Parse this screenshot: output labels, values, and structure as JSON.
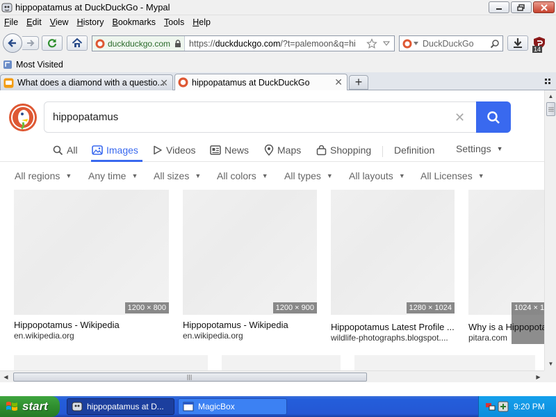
{
  "window": {
    "title": "hippopatamus at DuckDuckGo - Mypal"
  },
  "menu": [
    {
      "label": "File",
      "u": "F",
      "rest": "ile"
    },
    {
      "label": "Edit",
      "u": "E",
      "rest": "dit"
    },
    {
      "label": "View",
      "u": "V",
      "rest": "iew"
    },
    {
      "label": "History",
      "u": "H",
      "rest": "istory"
    },
    {
      "label": "Bookmarks",
      "u": "B",
      "rest": "ookmarks"
    },
    {
      "label": "Tools",
      "u": "T",
      "rest": "ools"
    },
    {
      "label": "Help",
      "u": "H",
      "rest": "elp"
    }
  ],
  "navbar": {
    "identity_site": "duckduckgo.com",
    "url_scheme": "https://",
    "url_host": "duckduckgo.com",
    "url_rest": "/?t=palemoon&q=hi",
    "search_placeholder": "DuckDuckGo",
    "addon_badge": "14"
  },
  "bookmarks": {
    "most_visited": "Most Visited"
  },
  "tabs": [
    {
      "label": "What does a diamond with a questio...",
      "active": false
    },
    {
      "label": "hippopatamus at DuckDuckGo",
      "active": true
    }
  ],
  "search": {
    "query": "hippopatamus"
  },
  "verticals": [
    {
      "label": "All",
      "icon": "search-icon"
    },
    {
      "label": "Images",
      "icon": "image-icon",
      "active": true
    },
    {
      "label": "Videos",
      "icon": "play-icon"
    },
    {
      "label": "News",
      "icon": "news-icon"
    },
    {
      "label": "Maps",
      "icon": "map-pin-icon"
    },
    {
      "label": "Shopping",
      "icon": "shopping-bag-icon"
    },
    {
      "label": "Definition",
      "icon": ""
    },
    {
      "label": "Settings",
      "icon": "chevron-down-icon"
    }
  ],
  "filters": [
    {
      "label": "All regions"
    },
    {
      "label": "Any time"
    },
    {
      "label": "All sizes"
    },
    {
      "label": "All colors"
    },
    {
      "label": "All types"
    },
    {
      "label": "All layouts"
    },
    {
      "label": "All Licenses"
    }
  ],
  "results": [
    {
      "title": "Hippopotamus - Wikipedia",
      "source": "en.wikipedia.org",
      "dims": "1200 × 800"
    },
    {
      "title": "Hippopotamus - Wikipedia",
      "source": "en.wikipedia.org",
      "dims": "1200 × 900"
    },
    {
      "title": "Hippopotamus Latest Profile ...",
      "source": "wildlife-photographs.blogspot....",
      "dims": "1280 × 1024"
    },
    {
      "title": "Why is a Hippopotamus",
      "source": "pitara.com",
      "dims": "1024 × 1"
    }
  ],
  "taskbar": {
    "start": "start",
    "tasks": [
      {
        "label": "hippopatamus at D..."
      },
      {
        "label": "MagicBox"
      }
    ],
    "clock": "9:20 PM"
  },
  "colors": {
    "accent": "#3969ef",
    "ddg_orange": "#de5833",
    "xp_blue": "#245edb",
    "xp_green": "#3a9a3a"
  }
}
